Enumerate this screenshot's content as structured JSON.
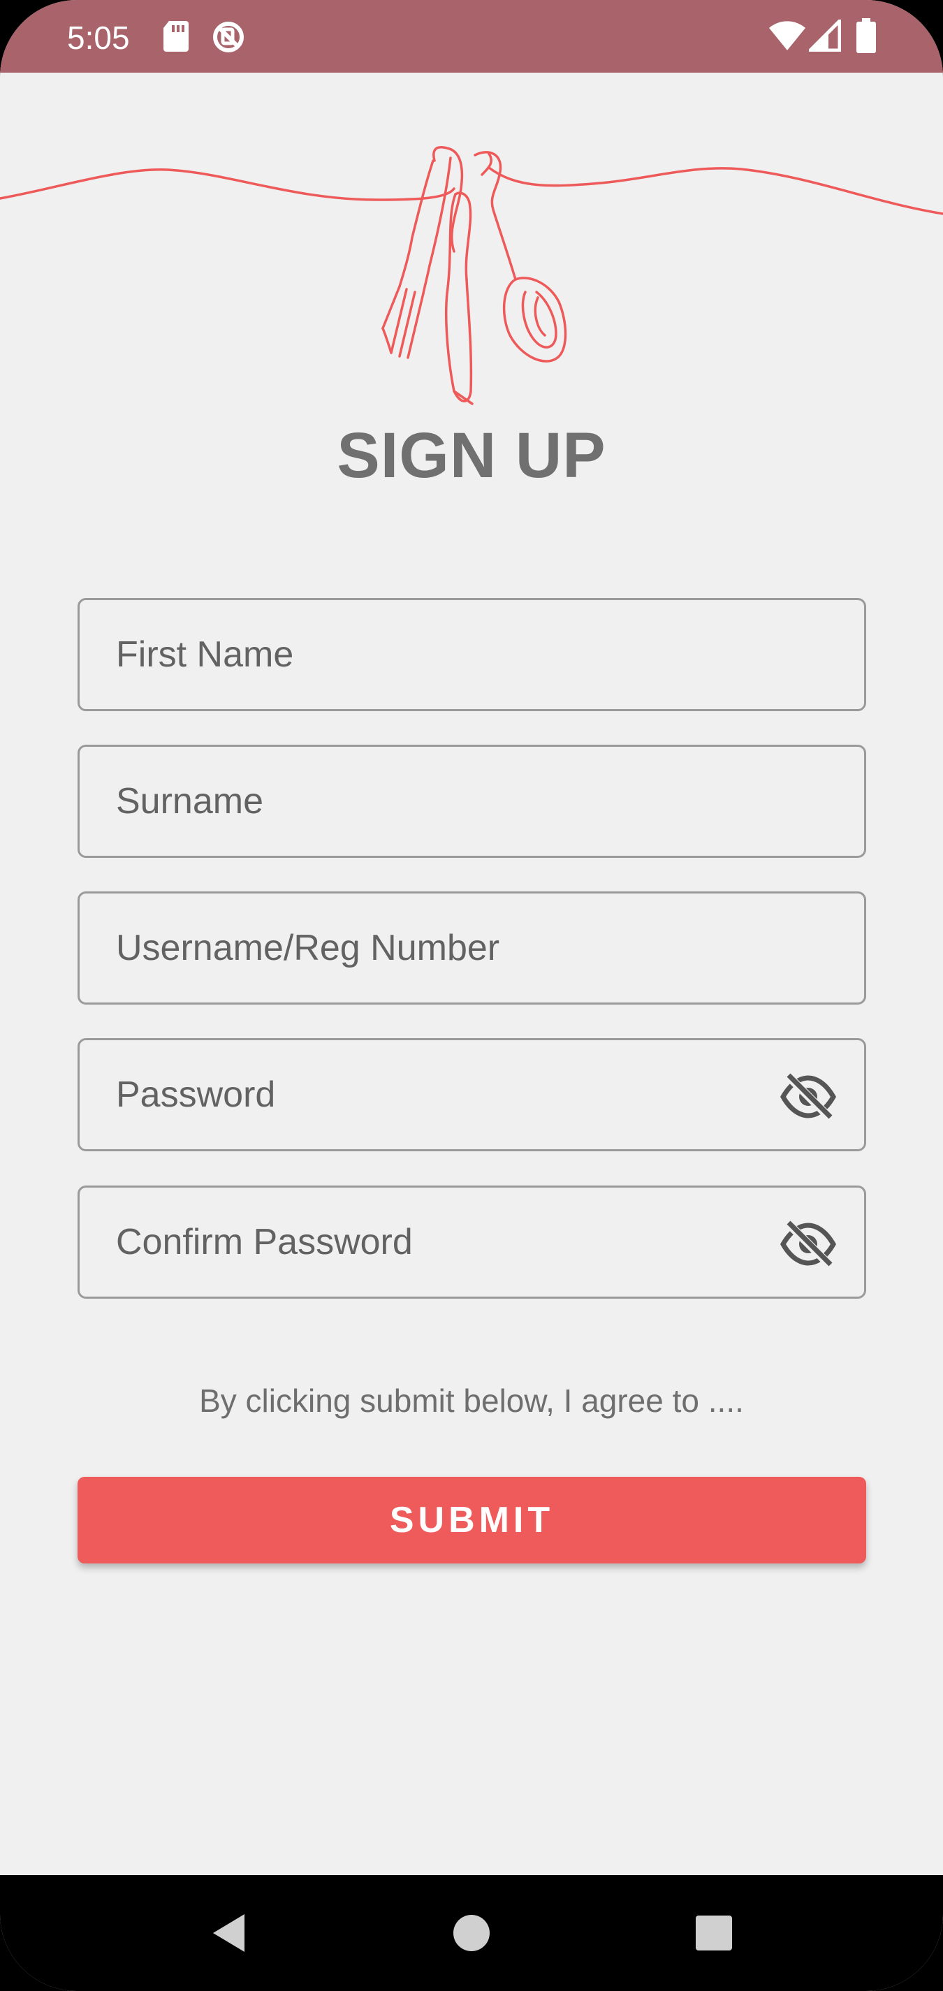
{
  "status_bar": {
    "time": "5:05",
    "icons": [
      "sd-card-icon",
      "no-sim-icon",
      "wifi-icon",
      "signal-icon",
      "battery-icon"
    ],
    "background": "#a9636a"
  },
  "logo": {
    "icon": "cutlery-line-art-icon",
    "color": "#ee5a5a"
  },
  "page": {
    "title": "SIGN UP"
  },
  "form": {
    "first_name": {
      "placeholder": "First Name",
      "value": ""
    },
    "surname": {
      "placeholder": "Surname",
      "value": ""
    },
    "username": {
      "placeholder": "Username/Reg Number",
      "value": ""
    },
    "password": {
      "placeholder": "Password",
      "value": "",
      "toggle_icon": "eye-off-icon"
    },
    "confirm_password": {
      "placeholder": "Confirm Password",
      "value": "",
      "toggle_icon": "eye-off-icon"
    }
  },
  "agreement_text": "By clicking submit below, I agree to ....",
  "submit_label": "SUBMIT",
  "accent_color": "#ef5a5a",
  "nav_bar": {
    "buttons": [
      "back-icon",
      "home-icon",
      "recents-icon"
    ]
  }
}
